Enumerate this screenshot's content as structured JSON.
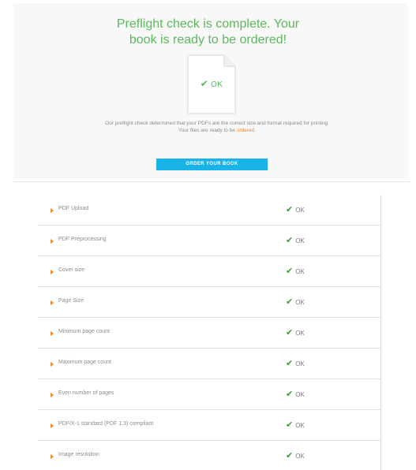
{
  "header": {
    "title_line1": "Preflight check is complete. Your",
    "title_line2": "book is ready to be ordered!"
  },
  "document_status": {
    "icon": "document-icon",
    "check_icon": "check-icon",
    "label": "OK"
  },
  "message": {
    "text": "Our preflight check determined that your PDFs are the correct size and format required for printing. Your files are ready to be",
    "link_text": "ordered."
  },
  "order_button": {
    "label": "ORDER YOUR BOOK"
  },
  "colors": {
    "success": "#5cb85c",
    "accent": "#f08a24",
    "button": "#1ab3e8"
  },
  "checks": [
    {
      "label": "PDF Upload",
      "status": "OK"
    },
    {
      "label": "PDF Preprocessing",
      "status": "OK"
    },
    {
      "label": "Cover size",
      "status": "OK"
    },
    {
      "label": "Page Size",
      "status": "OK"
    },
    {
      "label": "Minimum page count",
      "status": "OK"
    },
    {
      "label": "Maximum page count",
      "status": "OK"
    },
    {
      "label": "Even number of pages",
      "status": "OK"
    },
    {
      "label": "PDF/X-1 standard (PDF 1.3) compliant",
      "status": "OK"
    },
    {
      "label": "Image resolution",
      "status": "OK"
    }
  ]
}
